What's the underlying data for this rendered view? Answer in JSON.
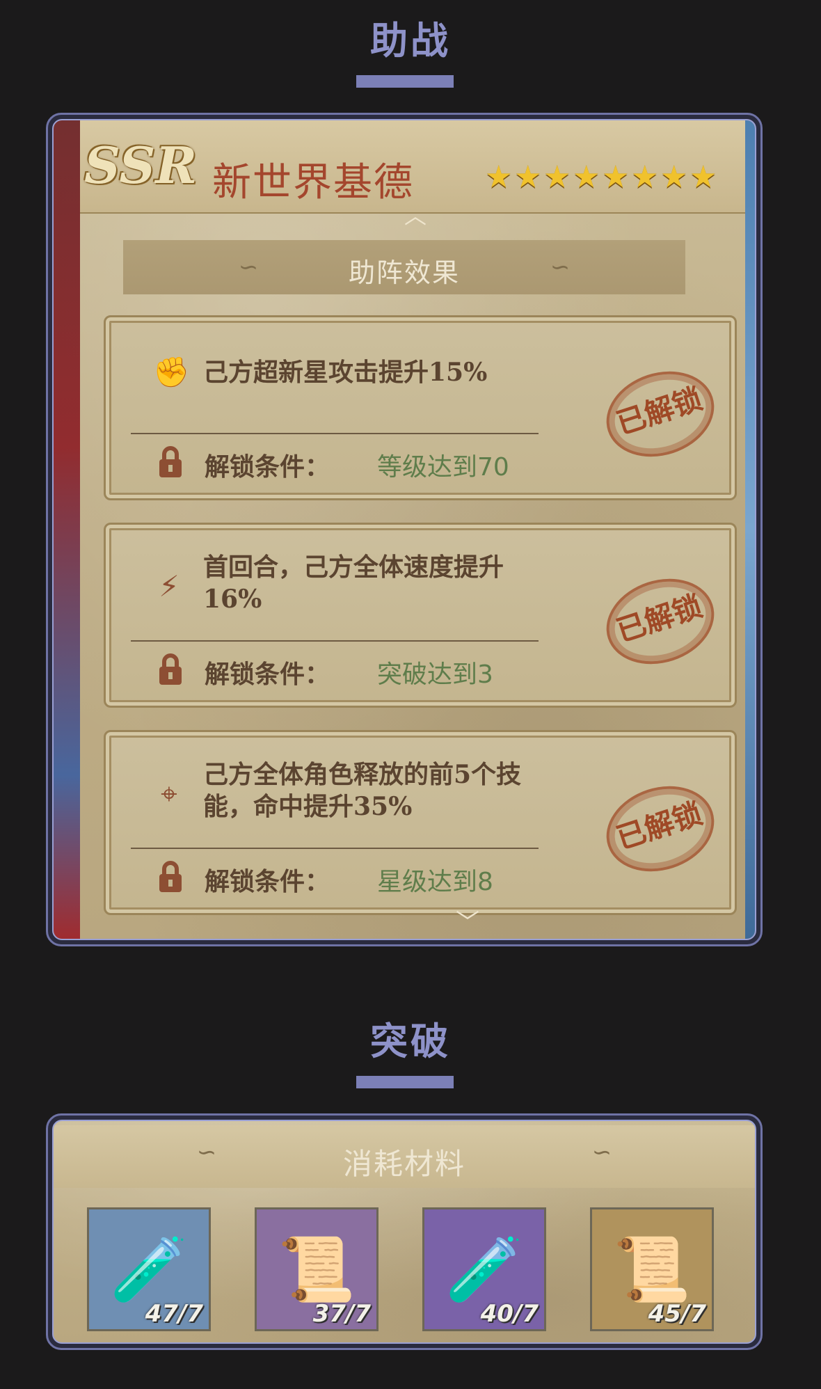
{
  "sections": {
    "assist_title": "助战",
    "breakthrough_title": "突破"
  },
  "card": {
    "rarity": "SSR",
    "name": "新世界基德",
    "stars": [
      "★",
      "★",
      "★",
      "★",
      "★",
      "★",
      "★",
      "★"
    ],
    "panel_title": "助阵效果",
    "effects": [
      {
        "icon": "muscle-arm-icon",
        "icon_glyph": "✊",
        "description": "己方超新星攻击提升15%",
        "condition_label": "解锁条件：",
        "condition_value": "等级达到70",
        "stamp": "已解锁"
      },
      {
        "icon": "lightning-icon",
        "icon_glyph": "⚡",
        "description": "首回合，己方全体速度提升16%",
        "condition_label": "解锁条件：",
        "condition_value": "突破达到3",
        "stamp": "已解锁"
      },
      {
        "icon": "crosshair-icon",
        "icon_glyph": "⌖",
        "description": "己方全体角色释放的前5个技能，命中提升35%",
        "condition_label": "解锁条件：",
        "condition_value": "星级达到8",
        "stamp": "已解锁"
      }
    ]
  },
  "materials": {
    "title": "消耗材料",
    "items": [
      {
        "icon": "blue-potion-bottle-icon",
        "count": "47/7",
        "bg": "#6f8fb3"
      },
      {
        "icon": "purple-scroll-map-icon",
        "count": "37/7",
        "bg": "#8a6fa0"
      },
      {
        "icon": "purple-potion-bottle-icon",
        "count": "40/7",
        "bg": "#7a62a8"
      },
      {
        "icon": "orange-scroll-map-icon",
        "count": "45/7",
        "bg": "#b0935d"
      }
    ]
  },
  "colors": {
    "accent": "#8e92c9",
    "condition_value": "#5f7d4b",
    "stamp": "#9f4926"
  }
}
